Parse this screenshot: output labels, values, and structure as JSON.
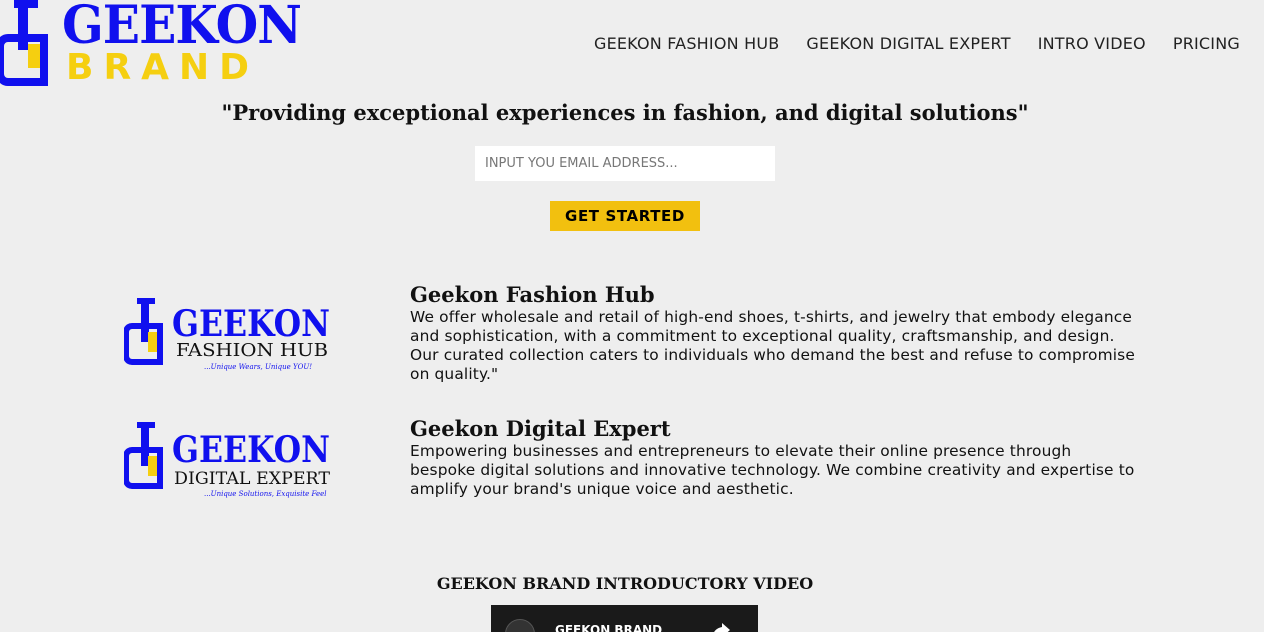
{
  "brand": {
    "logo_line1": "GEEKON",
    "logo_line2": "BRAND",
    "colors": {
      "blue": "#1010ee",
      "yellow": "#f5cf10"
    }
  },
  "nav": {
    "items": [
      {
        "label": "GEEKON FASHION HUB"
      },
      {
        "label": "GEEKON DIGITAL EXPERT"
      },
      {
        "label": "INTRO VIDEO"
      },
      {
        "label": "PRICING"
      }
    ]
  },
  "hero": {
    "tagline": "\"Providing exceptional experiences in fashion, and digital solutions\"",
    "email_placeholder": "INPUT YOU EMAIL ADDRESS...",
    "email_value": "",
    "cta_label": "GET STARTED",
    "cta_color": "#f2c00f"
  },
  "services": [
    {
      "logo_word": "GEEKON",
      "logo_sub": "FASHION HUB",
      "logo_slogan": "...Unique Wears, Unique YOU!",
      "title": "Geekon Fashion Hub",
      "description": "We offer wholesale and retail of high-end shoes, t-shirts, and jewelry that embody elegance and sophistication, with a commitment to exceptional quality, craftsmanship, and design. Our curated collection caters to individuals who demand the best and refuse to compromise on quality.\""
    },
    {
      "logo_word": "GEEKON",
      "logo_sub": "DIGITAL EXPERT",
      "logo_slogan": "...Unique Solutions, Exquisite Feel",
      "title": "Geekon Digital Expert",
      "description": "Empowering businesses and entrepreneurs to elevate their online presence through bespoke digital solutions and innovative technology. We combine creativity and expertise to amplify your brand's unique voice and aesthetic."
    }
  ],
  "video": {
    "section_title": "GEEKON BRAND INTRODUCTORY VIDEO",
    "player_label": "GEEKON BRAND",
    "icons": [
      "channel-avatar-icon",
      "share-icon"
    ]
  }
}
